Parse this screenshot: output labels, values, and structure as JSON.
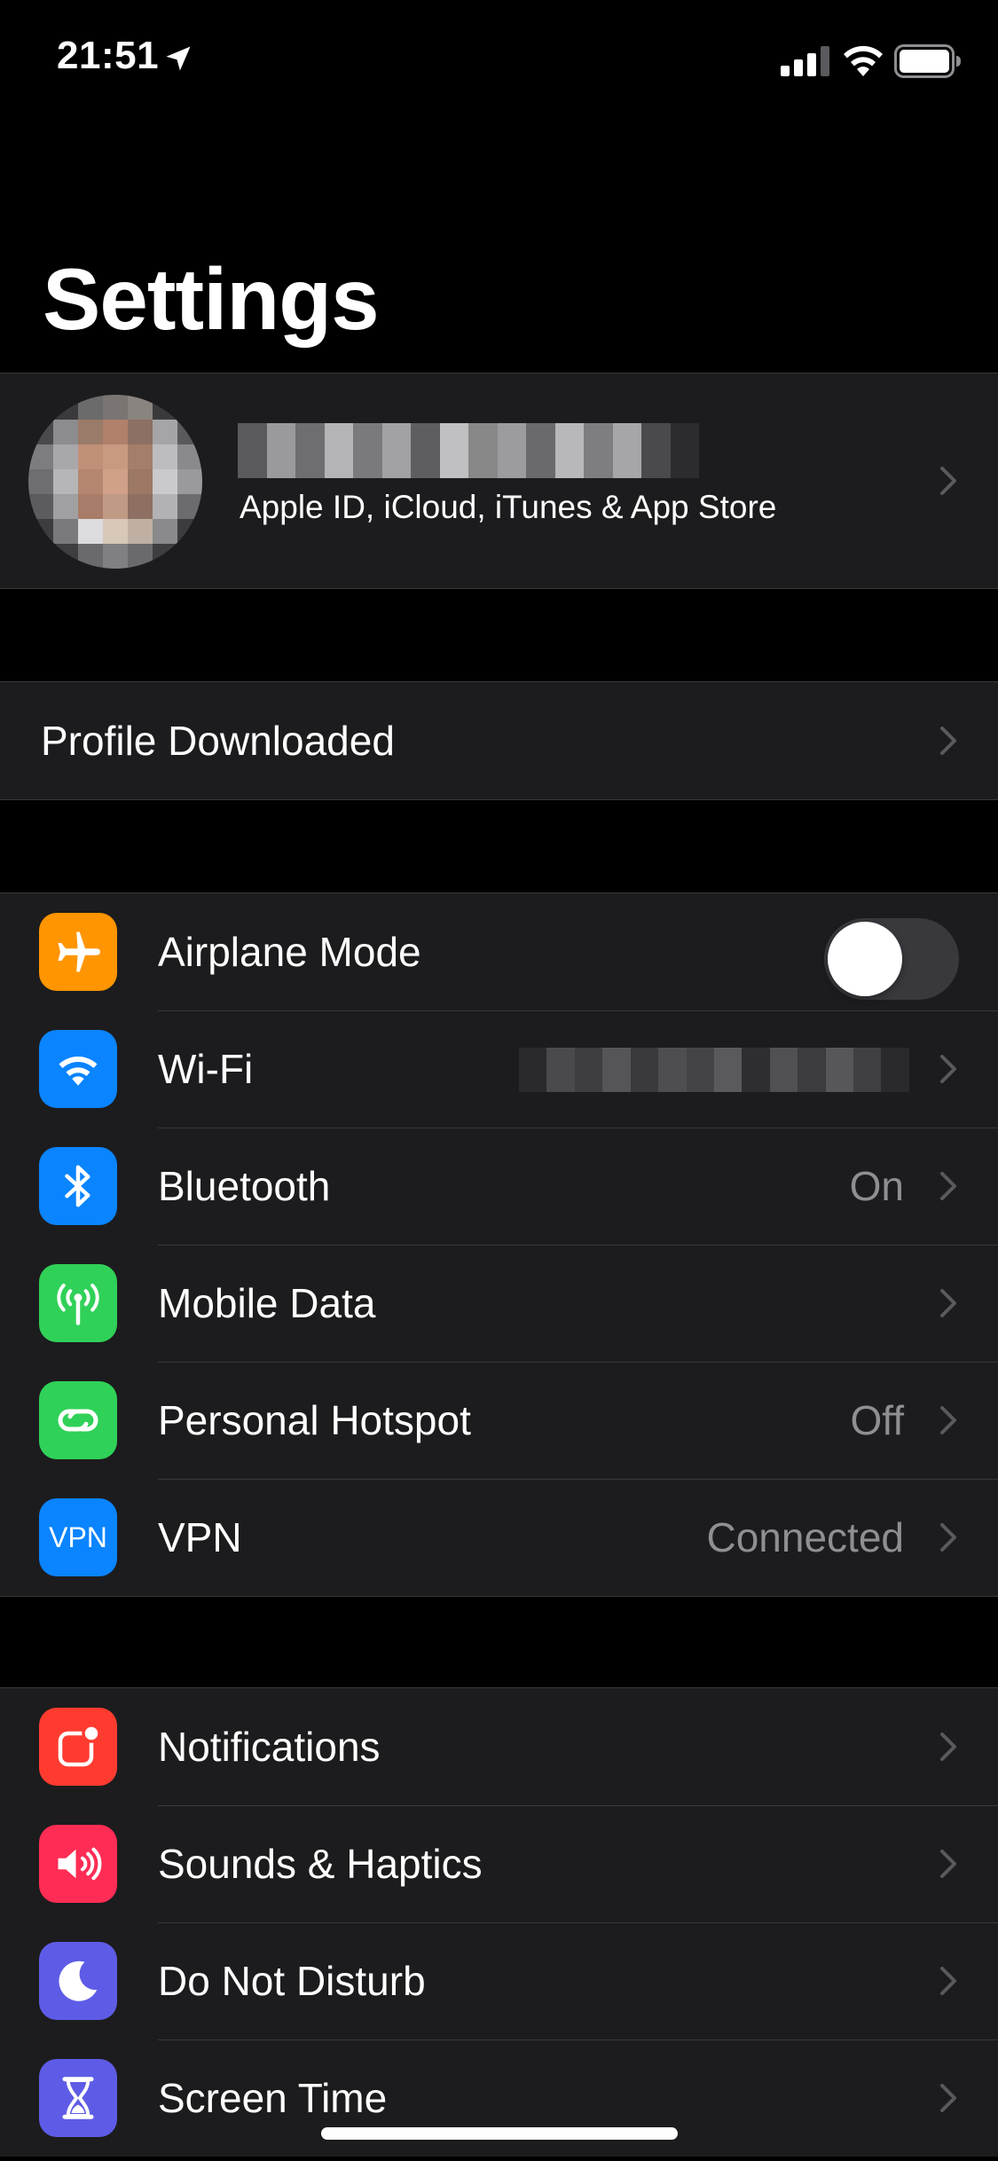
{
  "status_bar": {
    "time": "21:51",
    "icons": [
      "location-arrow-icon",
      "cellular-signal-icon",
      "wifi-icon",
      "battery-icon"
    ]
  },
  "title": "Settings",
  "profile": {
    "subtitle": "Apple ID, iCloud, iTunes & App Store",
    "name_redacted": true,
    "avatar_redacted": true
  },
  "profile_downloaded": {
    "label": "Profile Downloaded"
  },
  "connectivity": [
    {
      "id": "airplane",
      "label": "Airplane Mode",
      "icon": "airplane-icon",
      "color": "#ff9500",
      "toggle": false
    },
    {
      "id": "wifi",
      "label": "Wi-Fi",
      "icon": "wifi-icon",
      "color": "#0a84ff",
      "value_redacted": true
    },
    {
      "id": "bluetooth",
      "label": "Bluetooth",
      "icon": "bluetooth-icon",
      "color": "#0a84ff",
      "value": "On"
    },
    {
      "id": "mobile-data",
      "label": "Mobile Data",
      "icon": "antenna-icon",
      "color": "#30d158",
      "value": ""
    },
    {
      "id": "hotspot",
      "label": "Personal Hotspot",
      "icon": "hotspot-link-icon",
      "color": "#30d158",
      "value": "Off"
    },
    {
      "id": "vpn",
      "label": "VPN",
      "icon_text": "VPN",
      "color": "#0a84ff",
      "value": "Connected"
    }
  ],
  "general": [
    {
      "id": "notifications",
      "label": "Notifications",
      "icon": "notifications-icon",
      "color": "#ff3b30"
    },
    {
      "id": "sounds",
      "label": "Sounds & Haptics",
      "icon": "speaker-icon",
      "color": "#ff2d55"
    },
    {
      "id": "dnd",
      "label": "Do Not Disturb",
      "icon": "moon-icon",
      "color": "#5e5ce6"
    },
    {
      "id": "screen-time",
      "label": "Screen Time",
      "icon": "hourglass-icon",
      "color": "#5e5ce6"
    }
  ],
  "colors": {
    "background": "#000000",
    "cell": "#1c1c1e",
    "separator": "#38383a",
    "secondary_text": "#8e8e93",
    "chevron": "#5a5a5e",
    "toggle_off": "#39393d"
  }
}
